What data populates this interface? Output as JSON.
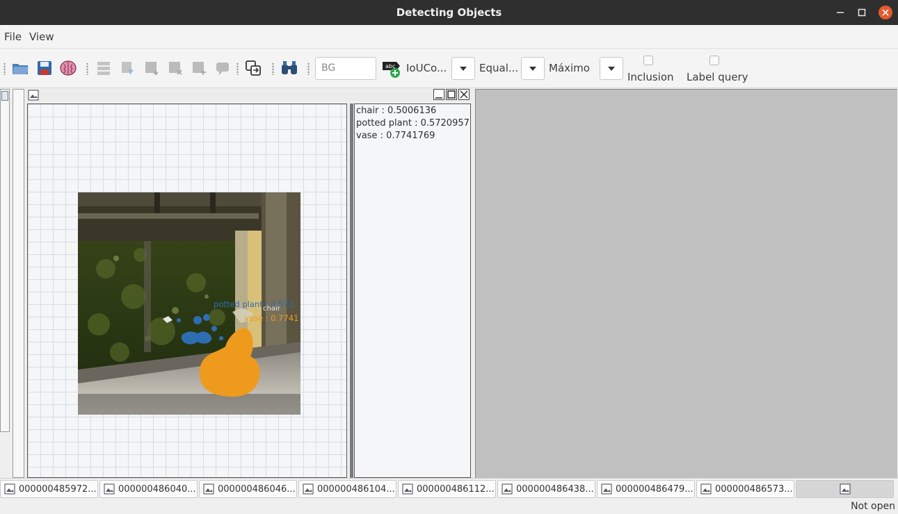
{
  "window": {
    "title": "Detecting Objects"
  },
  "menu": {
    "file": "File",
    "view": "View"
  },
  "toolbar": {
    "bg_field_value": "BG",
    "combo1_label": "IoUCo...",
    "combo2_label": "Equal...",
    "combo3_label": "Máximo",
    "inclusion_label": "Inclusion",
    "label_query_label": "Label query"
  },
  "results": [
    "chair : 0.5006136",
    "potted plant : 0.5720957",
    "vase : 0.7741769"
  ],
  "image_labels": {
    "potted_plant": "potted plant : 0.572",
    "chair": "chair",
    "vase": "vase : 0.7741"
  },
  "colors": {
    "potted_plant": "#2f6db3",
    "vase": "#ee9a1d",
    "chair": "#e6e6e6"
  },
  "tabs": [
    "000000485972....",
    "000000486040....",
    "000000486046....",
    "000000486104....",
    "000000486112....",
    "000000486438....",
    "000000486479....",
    "000000486573...."
  ],
  "status": "Not open"
}
